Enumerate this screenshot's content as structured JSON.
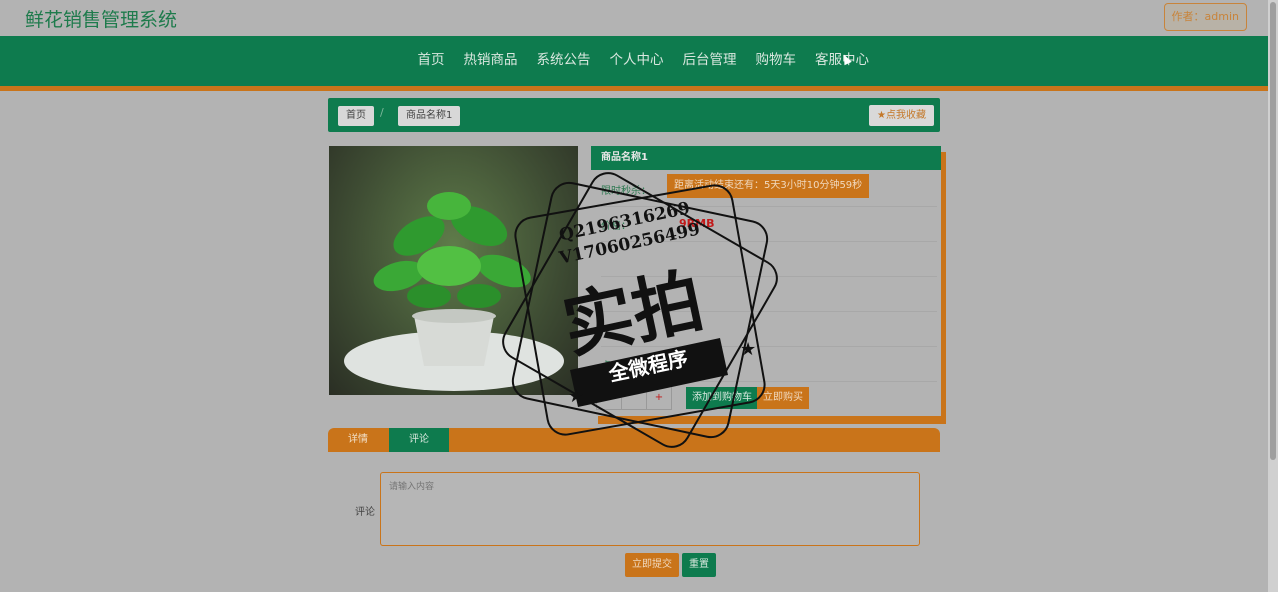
{
  "site": {
    "title": "鲜花销售管理系统",
    "author_label": "作者：admin"
  },
  "nav": {
    "items": [
      "首页",
      "热销商品",
      "系统公告",
      "个人中心",
      "后台管理",
      "购物车",
      "客服中心"
    ]
  },
  "breadcrumb": {
    "home": "首页",
    "separator": "/",
    "current": "商品名称1",
    "favorite": "★点我收藏"
  },
  "product": {
    "name": "商品名称1",
    "rows": [
      {
        "label": "限时秒杀：",
        "value": "距离活动结束还有：5天3小时10分钟59秒"
      },
      {
        "label": "价格：",
        "value": "9RMB"
      },
      {
        "label": "",
        "value": ""
      },
      {
        "label": "",
        "value": ""
      },
      {
        "label": "",
        "value": ""
      },
      {
        "label": "点击次数：",
        "value": ""
      }
    ],
    "qty": [
      "-",
      "",
      "+"
    ],
    "add_to_cart": "添加到购物车",
    "buy_now": "立即购买"
  },
  "tabs": [
    "详情",
    "评论"
  ],
  "comment": {
    "label": "评论",
    "placeholder": "请输入内容",
    "submit": "立即提交",
    "reset": "重置"
  },
  "watermark": {
    "line1": "Q2196316269",
    "line2": "V17060256499",
    "big": "实拍",
    "banner": "全微程序"
  },
  "colors": {
    "green": "#0e7b4e",
    "orange": "#c9741a",
    "price": "#c21a1a"
  }
}
